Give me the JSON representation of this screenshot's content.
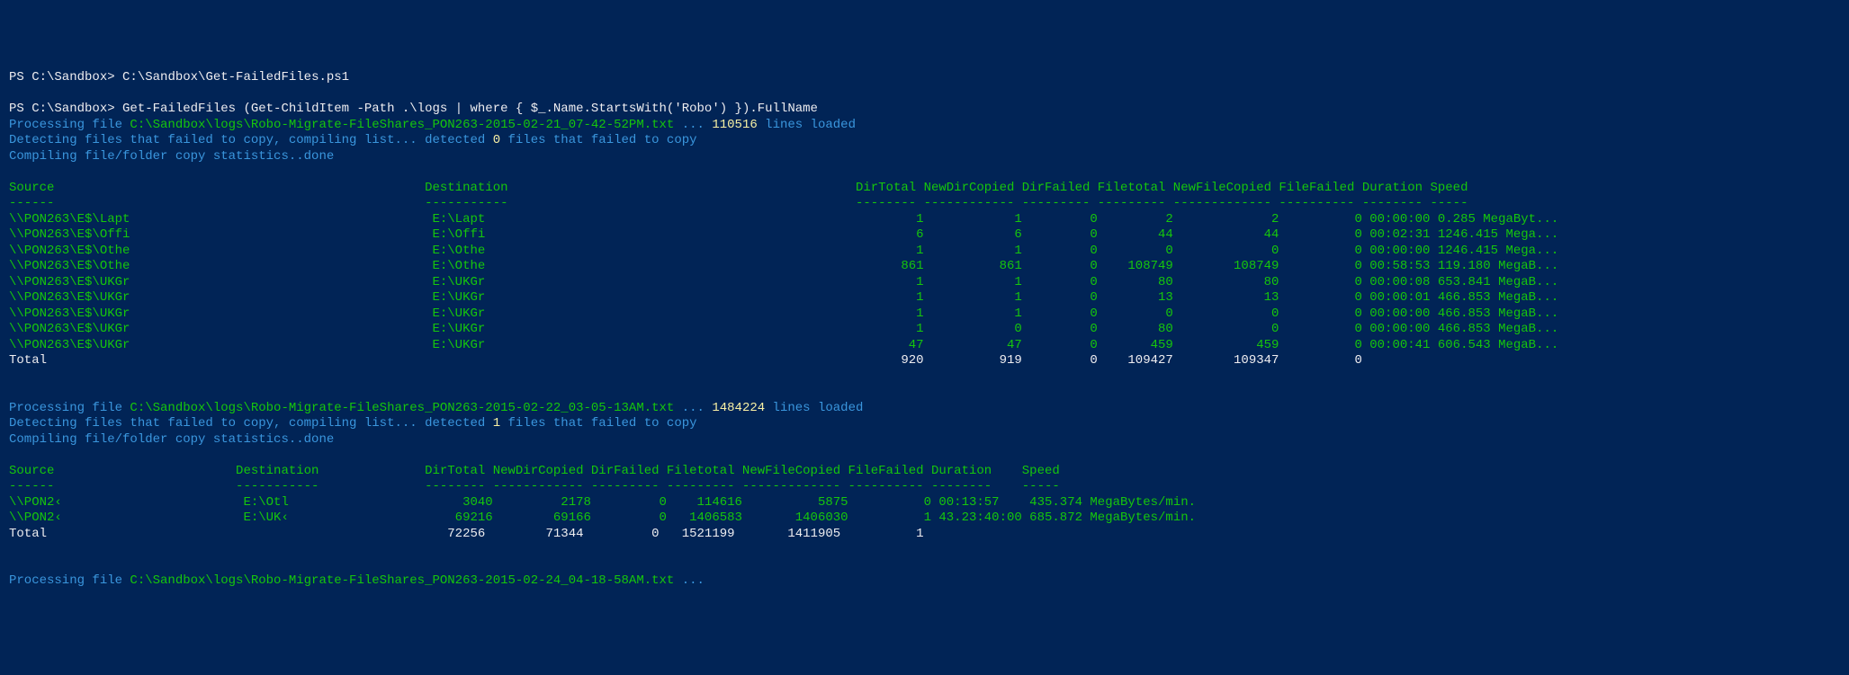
{
  "prompt1": "PS C:\\Sandbox> ",
  "cmd1": "C:\\Sandbox\\Get-FailedFiles.ps1",
  "prompt2": "PS C:\\Sandbox> ",
  "cmd2": "Get-FailedFiles (Get-ChildItem -Path .\\logs | where { $_.Name.StartsWith('Robo') }).FullName",
  "proc1_a": "Processing file ",
  "proc1_b": "C:\\Sandbox\\logs\\Robo-Migrate-FileShares_PON263-2015-02-21_07-42-52PM.txt",
  "proc1_c": " ... ",
  "proc1_d": "110516",
  "proc1_e": " lines loaded",
  "detect1_a": "Detecting files that failed to copy, compiling list... detected ",
  "detect1_b": "0",
  "detect1_c": " files that failed to copy",
  "compile1": "Compiling file/folder copy statistics..done",
  "t1_hdr": "Source                                                 Destination                                              DirTotal NewDirCopied DirFailed Filetotal NewFileCopied FileFailed Duration Speed",
  "t1_dash": "------                                                 -----------                                              -------- ------------ --------- --------- ------------- ---------- -------- -----",
  "t1_r1": "\\\\PON263\\E$\\Lapt                                        E:\\Lapt                                                         1            1         0         2             2          0 00:00:00 0.285 MegaByt...",
  "t1_r2": "\\\\PON263\\E$\\Offi                                        E:\\Offi                                                         6            6         0        44            44          0 00:02:31 1246.415 Mega...",
  "t1_r3": "\\\\PON263\\E$\\Othe                                        E:\\Othe                                                         1            1         0         0             0          0 00:00:00 1246.415 Mega...",
  "t1_r4": "\\\\PON263\\E$\\Othe                                        E:\\Othe                                                       861          861         0    108749        108749          0 00:58:53 119.180 MegaB...",
  "t1_r5": "\\\\PON263\\E$\\UKGr                                        E:\\UKGr                                                         1            1         0        80            80          0 00:00:08 653.841 MegaB...",
  "t1_r6": "\\\\PON263\\E$\\UKGr                                        E:\\UKGr                                                         1            1         0        13            13          0 00:00:01 466.853 MegaB...",
  "t1_r7": "\\\\PON263\\E$\\UKGr                                        E:\\UKGr                                                         1            1         0         0             0          0 00:00:00 466.853 MegaB...",
  "t1_r8": "\\\\PON263\\E$\\UKGr                                        E:\\UKGr                                                         1            0         0        80             0          0 00:00:00 466.853 MegaB...",
  "t1_r9": "\\\\PON263\\E$\\UKGr                                        E:\\UKGr                                                        47           47         0       459           459          0 00:00:41 606.543 MegaB...",
  "t1_tot": "Total                                                                                                                 920          919         0    109427        109347          0",
  "proc2_a": "Processing file ",
  "proc2_b": "C:\\Sandbox\\logs\\Robo-Migrate-FileShares_PON263-2015-02-22_03-05-13AM.txt",
  "proc2_c": " ... ",
  "proc2_d": "1484224",
  "proc2_e": " lines loaded",
  "detect2_a": "Detecting files that failed to copy, compiling list... detected ",
  "detect2_b": "1",
  "detect2_c": " files that failed to copy",
  "compile2": "Compiling file/folder copy statistics..done",
  "t2_hdr": "Source                        Destination              DirTotal NewDirCopied DirFailed Filetotal NewFileCopied FileFailed Duration    Speed",
  "t2_dash": "------                        -----------              -------- ------------ --------- --------- ------------- ---------- --------    -----",
  "t2_r1": "\\\\PON2‹                        E:\\Otl                       3040         2178         0    114616          5875          0 00:13:57    435.374 MegaBytes/min.",
  "t2_r2": "\\\\PON2‹                        E:\\UK‹                      69216        69166         0   1406583       1406030          1 43.23:40:00 685.872 MegaBytes/min.",
  "t2_tot": "Total                                                     72256        71344         0   1521199       1411905          1",
  "proc3_a": "Processing file ",
  "proc3_b": "C:\\Sandbox\\logs\\Robo-Migrate-FileShares_PON263-2015-02-24_04-18-58AM.txt",
  "proc3_c": " ..."
}
